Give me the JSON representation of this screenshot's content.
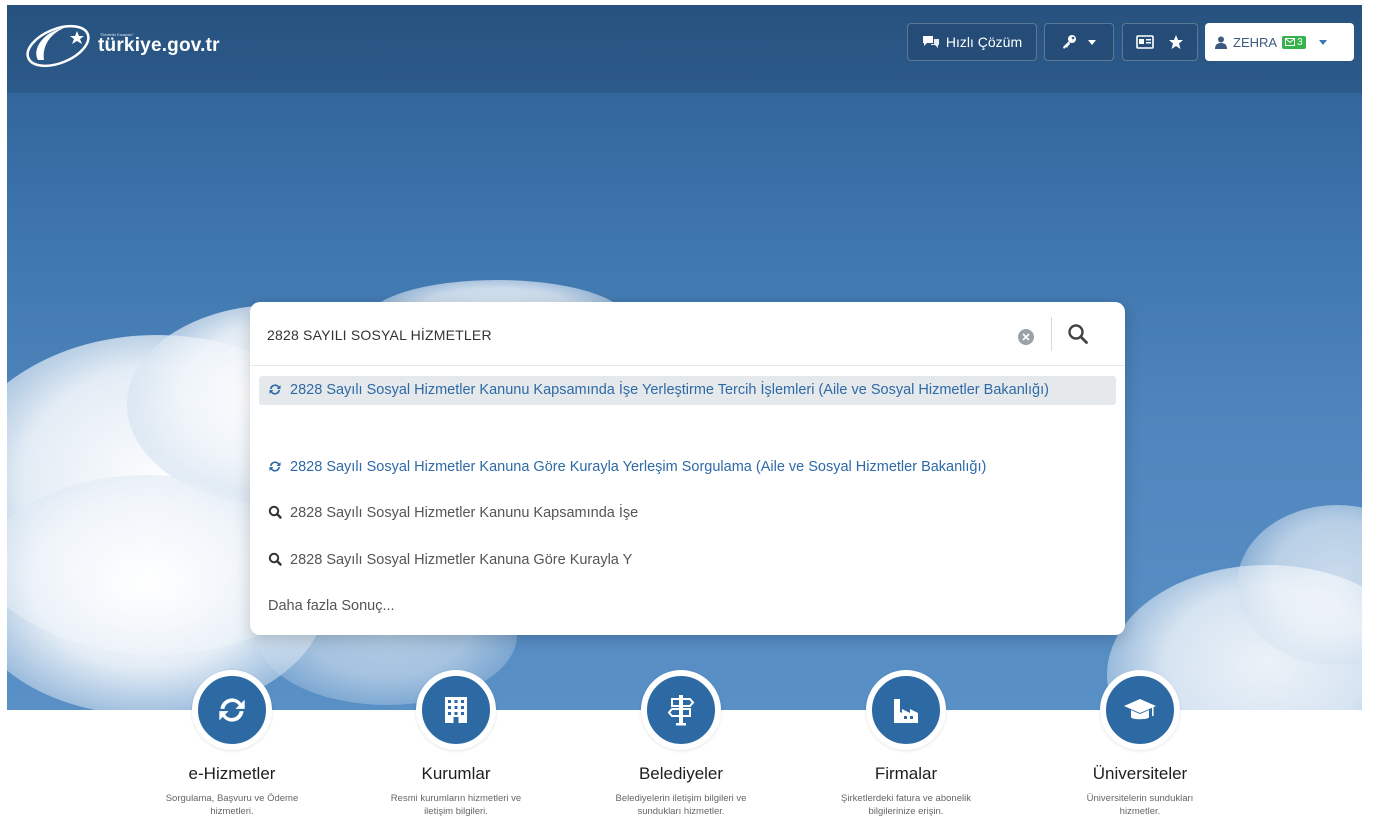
{
  "header": {
    "brand": "türkiye.gov.tr",
    "brand_tagline": "\"Devletin Kısayolu\"",
    "quick_solution_label": "Hızlı Çözüm",
    "user_name": "ZEHRA",
    "mail_count": "3"
  },
  "search": {
    "value": "2828 SAYILI SOSYAL HİZMETLER",
    "suggestions": [
      {
        "text": "2828 Sayılı Sosyal Hizmetler Kanunu Kapsamında İşe Yerleştirme Tercih İşlemleri (Aile ve Sosyal Hizmetler Bakanlığı)",
        "icon": "refresh-icon"
      },
      {
        "text": "2828 Sayılı Sosyal Hizmetler Kanuna Göre Kurayla Yerleşim Sorgulama (Aile ve Sosyal Hizmetler Bakanlığı)",
        "icon": "refresh-icon"
      },
      {
        "text": "2828 Sayılı Sosyal Hizmetler Kanunu Kapsamında İşe",
        "icon": "search-icon"
      },
      {
        "text": "2828 Sayılı Sosyal Hizmetler Kanuna Göre Kurayla Y",
        "icon": "search-icon"
      }
    ],
    "more_results": "Daha fazla Sonuç..."
  },
  "categories": [
    {
      "title": "e-Hizmetler",
      "desc": "Sorgulama, Başvuru ve Ödeme hizmetleri.",
      "icon": "refresh-icon"
    },
    {
      "title": "Kurumlar",
      "desc": "Resmi kurumların hizmetleri ve iletişim bilgileri.",
      "icon": "building-icon"
    },
    {
      "title": "Belediyeler",
      "desc": "Belediyelerin iletişim bilgileri ve sundukları hizmetler.",
      "icon": "signpost-icon"
    },
    {
      "title": "Firmalar",
      "desc": "Şirketlerdeki fatura ve abonelik bilgilerinize erişin.",
      "icon": "factory-icon"
    },
    {
      "title": "Üniversiteler",
      "desc": "Üniversitelerin sundukları hizmetler.",
      "icon": "graduation-cap-icon"
    }
  ],
  "colors": {
    "primary_blue": "#2d6aa3",
    "link_blue": "#2e6aa6",
    "badge_green": "#37b24d"
  }
}
